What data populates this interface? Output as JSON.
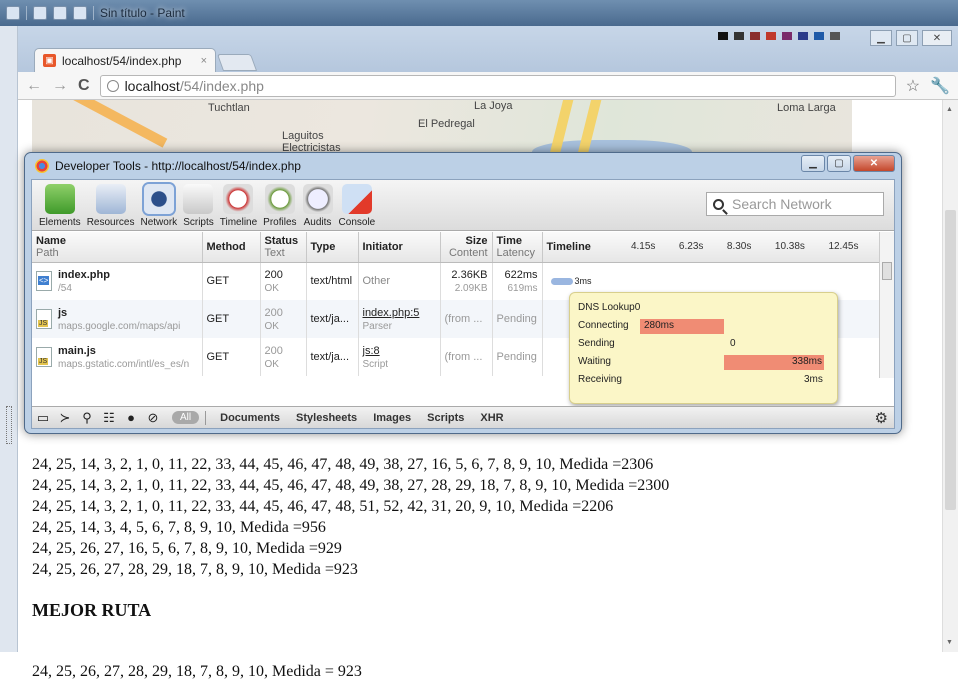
{
  "paint": {
    "title": "Sin título - Paint"
  },
  "browser": {
    "tab_title": "localhost/54/index.php",
    "tab_close": "×",
    "url_host": "localhost",
    "url_path": "/54/index.php",
    "star": "☆",
    "wrench": "🔧"
  },
  "map": {
    "labels": [
      "Tuchtlan",
      "La Joya",
      "El Pedregal",
      "Laguitos",
      "Electricistas",
      "Loma Larga"
    ]
  },
  "devtools": {
    "title": "Developer Tools - http://localhost/54/index.php",
    "tools": [
      "Elements",
      "Resources",
      "Network",
      "Scripts",
      "Timeline",
      "Profiles",
      "Audits",
      "Console"
    ],
    "search_placeholder": "Search Network",
    "columns": {
      "name": "Name",
      "name_sub": "Path",
      "method": "Method",
      "status": "Status",
      "status_sub": "Text",
      "type": "Type",
      "initiator": "Initiator",
      "size": "Size",
      "size_sub": "Content",
      "time": "Time",
      "time_sub": "Latency",
      "timeline": "Timeline"
    },
    "timeline_ticks": [
      "4.15s",
      "6.23s",
      "8.30s",
      "10.38s",
      "12.45s"
    ],
    "rows": [
      {
        "name": "index.php",
        "path": "/54",
        "method": "GET",
        "status": "200",
        "status_text": "OK",
        "type": "text/html",
        "initiator": "Other",
        "initiator_sub": "",
        "size": "2.36KB",
        "size_sub": "2.09KB",
        "time": "622ms",
        "time_sub": "619ms",
        "icon": "php",
        "bar_label": "3ms"
      },
      {
        "name": "js",
        "path": "maps.google.com/maps/api",
        "method": "GET",
        "status": "200",
        "status_text": "OK",
        "type": "text/ja...",
        "initiator": "index.php:5",
        "initiator_sub": "Parser",
        "size": "(from ...",
        "size_sub": "",
        "time": "Pending",
        "time_sub": "",
        "icon": "js",
        "bar_label": ""
      },
      {
        "name": "main.js",
        "path": "maps.gstatic.com/intl/es_es/n",
        "method": "GET",
        "status": "200",
        "status_text": "OK",
        "type": "text/ja...",
        "initiator": "js:8",
        "initiator_sub": "Script",
        "size": "(from ...",
        "size_sub": "",
        "time": "Pending",
        "time_sub": "",
        "icon": "js",
        "bar_label": ""
      }
    ],
    "popover": {
      "dns_label": "DNS Lookup",
      "dns_value": "0",
      "connecting_label": "Connecting",
      "connecting_value": "280ms",
      "sending_label": "Sending",
      "sending_value": "0",
      "waiting_label": "Waiting",
      "waiting_value": "338ms",
      "receiving_label": "Receiving",
      "receiving_value": "3ms"
    },
    "filters": [
      "All",
      "Documents",
      "Stylesheets",
      "Images",
      "Scripts",
      "XHR"
    ]
  },
  "content": {
    "lines": [
      "24, 25, 14, 3, 2, 1, 0, 11, 22, 33, 44, 45, 46, 47, 48, 49, 38, 27, 16, 5, 6, 7, 8, 9, 10, Medida =2306",
      "24, 25, 14, 3, 2, 1, 0, 11, 22, 33, 44, 45, 46, 47, 48, 49, 38, 27, 28, 29, 18, 7, 8, 9, 10, Medida =2300",
      "24, 25, 14, 3, 2, 1, 0, 11, 22, 33, 44, 45, 46, 47, 48, 51, 52, 42, 31, 20, 9, 10, Medida =2206",
      "24, 25, 14, 3, 4, 5, 6, 7, 8, 9, 10, Medida =956",
      "24, 25, 26, 27, 16, 5, 6, 7, 8, 9, 10, Medida =929",
      "24, 25, 26, 27, 28, 29, 18, 7, 8, 9, 10, Medida =923"
    ],
    "heading": "MEJOR RUTA",
    "result": "24, 25, 26, 27, 28, 29, 18, 7, 8, 9, 10, Medida = 923"
  }
}
